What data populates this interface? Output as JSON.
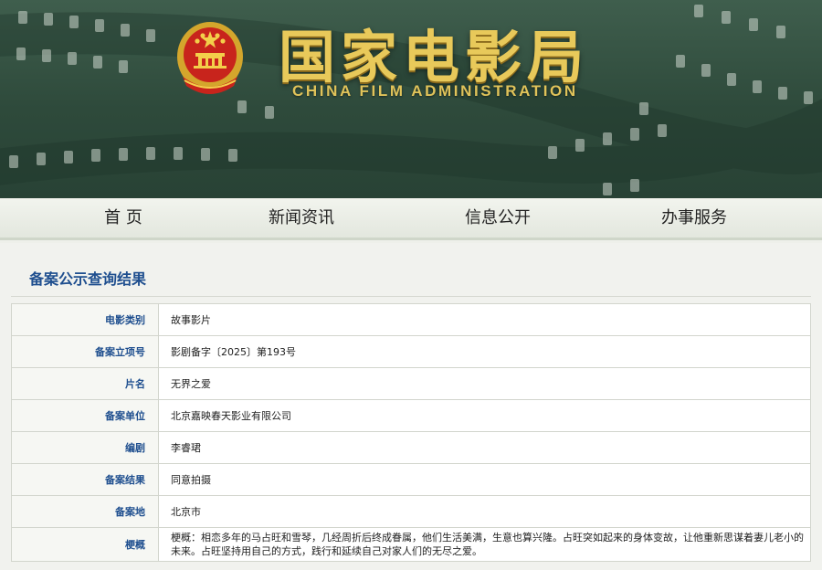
{
  "header": {
    "title_cn": "国家电影局",
    "title_en": "CHINA FILM ADMINISTRATION"
  },
  "nav": {
    "items": [
      {
        "label": "首 页"
      },
      {
        "label": "新闻资讯"
      },
      {
        "label": "信息公开"
      },
      {
        "label": "办事服务"
      }
    ]
  },
  "main": {
    "section_title": "备案公示查询结果",
    "rows": [
      {
        "label": "电影类别",
        "value": "故事影片"
      },
      {
        "label": "备案立项号",
        "value": "影剧备字〔2025〕第193号"
      },
      {
        "label": "片名",
        "value": "无界之爱"
      },
      {
        "label": "备案单位",
        "value": "北京嘉映春天影业有限公司"
      },
      {
        "label": "编剧",
        "value": "李睿珺"
      },
      {
        "label": "备案结果",
        "value": "同意拍摄"
      },
      {
        "label": "备案地",
        "value": "北京市"
      },
      {
        "label": "梗概",
        "value": "梗概：相恋多年的马占旺和雪琴，几经周折后终成眷属，他们生活美满，生意也算兴隆。占旺突如起来的身体变故，让他重新思谋着妻儿老小的未来。占旺坚持用自己的方式，践行和延续自己对家人们的无尽之爱。"
      }
    ]
  },
  "colors": {
    "banner": "#2e4a3b",
    "gold": "#e8c95a",
    "label_blue": "#1f4f8f"
  }
}
